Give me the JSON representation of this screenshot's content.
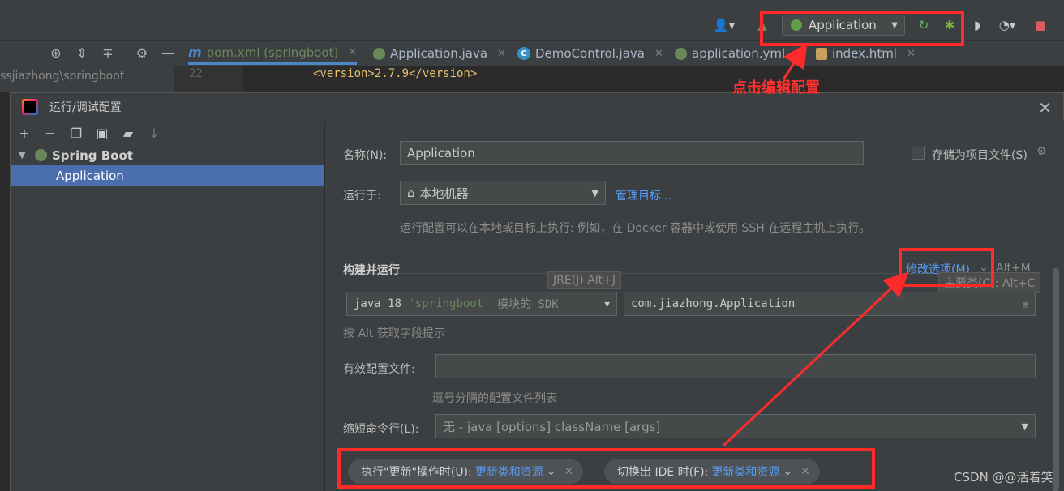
{
  "toolbar": {
    "run_config": "Application"
  },
  "editor_tabs": [
    {
      "label": "pom.xml (springboot)",
      "icon": "maven-icon",
      "active": true
    },
    {
      "label": "Application.java",
      "icon": "spring-boot-class-icon"
    },
    {
      "label": "DemoControl.java",
      "icon": "class-icon"
    },
    {
      "label": "application.yml",
      "icon": "spring-config-icon"
    },
    {
      "label": "index.html",
      "icon": "html-icon"
    }
  ],
  "project_path": "ssjiazhong\\springboot",
  "editor": {
    "line_number": "22",
    "line_text": "<version>2.7.9</version>"
  },
  "annotation": "点击编辑配置",
  "dialog": {
    "title": "运行/调试配置",
    "tree": {
      "group": "Spring Boot",
      "selected": "Application"
    },
    "name_label": "名称(N):",
    "name_value": "Application",
    "store_as_project_file": "存储为项目文件(S)",
    "run_on_label": "运行于:",
    "run_on_value": "本地机器",
    "manage_targets": "管理目标...",
    "run_on_hint": "运行配置可以在本地或目标上执行: 例如，在 Docker 容器中或使用 SSH 在远程主机上执行。",
    "build_run_title": "构建并运行",
    "modify_options": "修改选项(M)",
    "modify_shortcut": "Alt+M",
    "jre_tooltip": "JRE(J) Alt+J",
    "main_class_tooltip": "主要类(C): Alt+C",
    "sdk_prefix": "java 18 ",
    "sdk_module": "'springboot'",
    "sdk_suffix": " 模块的 SDK",
    "main_class": "com.jiazhong.Application",
    "alt_hint": "按 Alt 获取字段提示",
    "active_profiles_label": "有效配置文件:",
    "active_profiles_value": "",
    "profiles_hint": "逗号分隔的配置文件列表",
    "shorten_cmd_label": "缩短命令行(L):",
    "shorten_cmd_value": "无 - java [options] className [args]",
    "update_action_label": "执行\"更新\"操作时(U):",
    "update_action_value": "更新类和资源",
    "frame_deactivation_label": "切换出 IDE 时(F):",
    "frame_deactivation_value": "更新类和资源"
  },
  "watermark": "CSDN @@活着笑",
  "colors": {
    "highlight_red": "#ff2b2b",
    "selection_blue": "#4b6eaf",
    "link_blue": "#589df6"
  }
}
